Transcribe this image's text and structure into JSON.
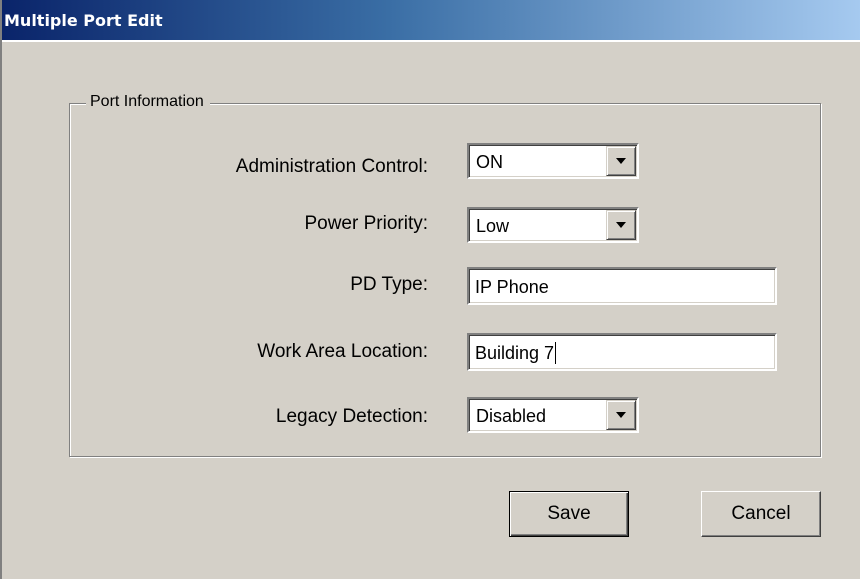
{
  "window": {
    "title": "Multiple Port Edit"
  },
  "group": {
    "legend": "Port Information"
  },
  "fields": {
    "admin_control": {
      "label": "Administration Control:",
      "value": "ON"
    },
    "power_priority": {
      "label": "Power Priority:",
      "value": "Low"
    },
    "pd_type": {
      "label": "PD Type:",
      "value": "IP Phone"
    },
    "work_area_location": {
      "label": "Work Area Location:",
      "value": "Building 7"
    },
    "legacy_detection": {
      "label": "Legacy Detection:",
      "value": "Disabled"
    }
  },
  "buttons": {
    "save_label": "Save",
    "cancel_label": "Cancel"
  },
  "icons": {
    "dropdown": "chevron-down-icon"
  },
  "colors": {
    "titlebar_start": "#0a246a",
    "titlebar_end": "#a6caf0",
    "window_bg": "#d4d0c8"
  }
}
